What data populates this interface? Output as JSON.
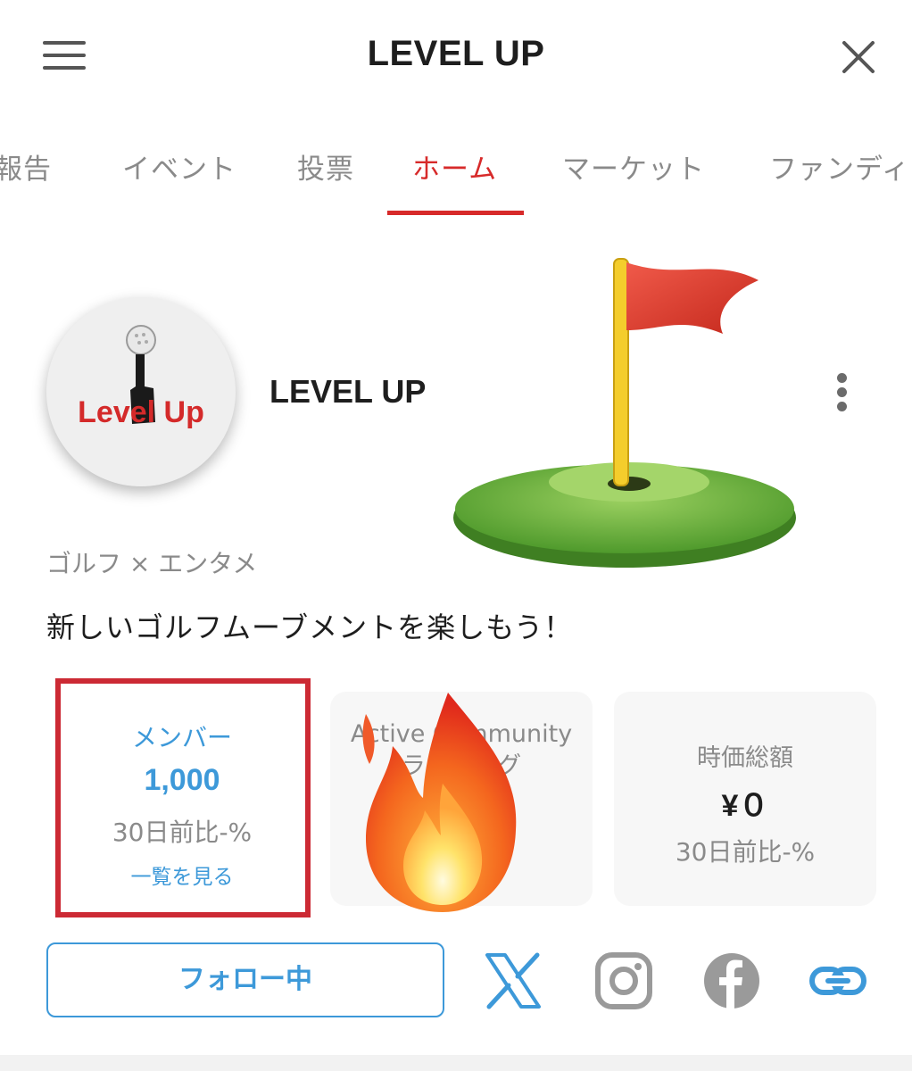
{
  "header": {
    "title": "LEVEL UP",
    "menu_icon": "hamburger-menu-icon",
    "close_icon": "close-icon"
  },
  "tabs": [
    {
      "label": "報告",
      "active": false
    },
    {
      "label": "イベント",
      "active": false
    },
    {
      "label": "投票",
      "active": false
    },
    {
      "label": "ホーム",
      "active": true
    },
    {
      "label": "マーケット",
      "active": false
    },
    {
      "label": "ファンディ",
      "active": false
    }
  ],
  "profile": {
    "logo_text": "Level Up",
    "name": "LEVEL UP",
    "category": "ゴルフ × エンタメ",
    "tagline": "新しいゴルフムーブメントを楽しもう！"
  },
  "stats": {
    "members": {
      "label": "メンバー",
      "value": "1,000",
      "change": "30日前比-%",
      "link": "一覧を見る"
    },
    "active": {
      "label_line1": "Active Community",
      "label_line2": "ランキング"
    },
    "market": {
      "label": "時価総額",
      "value": "¥０",
      "change": "30日前比-%"
    }
  },
  "actions": {
    "follow_label": "フォロー中"
  },
  "social_icons": [
    "x-icon",
    "instagram-icon",
    "facebook-icon",
    "link-icon"
  ],
  "colors": {
    "accent_red": "#d72a2a",
    "highlight_red": "#cc2a34",
    "link_blue": "#3d99d9",
    "muted_gray": "#8a8a8a"
  }
}
